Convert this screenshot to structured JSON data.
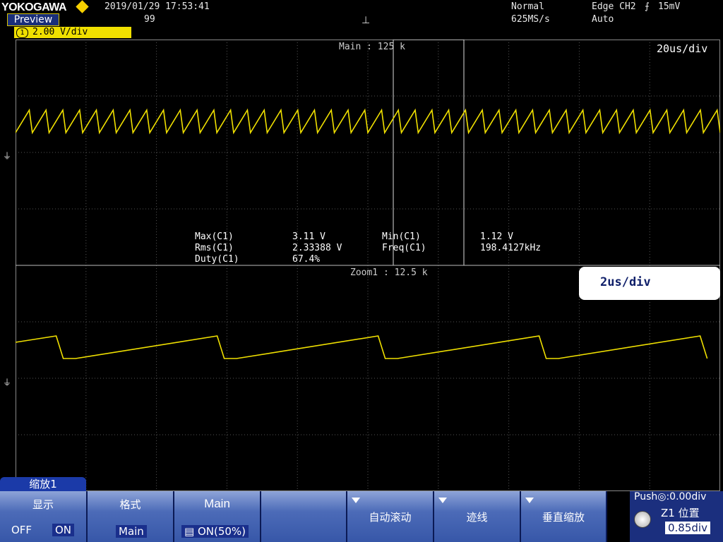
{
  "header": {
    "brand": "YOKOGAWA",
    "preview_label": "Preview",
    "datetime": "2019/01/29  17:53:41",
    "acq_count": "99",
    "acq_mode": "Normal",
    "sample_rate": "625MS/s",
    "trigger_type": "Edge CH2",
    "trigger_level": "15mV",
    "trigger_mode": "Auto",
    "trigger_position_symbol": "⊥"
  },
  "channel": {
    "number": "1",
    "scale": "2.00 V/div",
    "color": "#f0e000"
  },
  "main_window": {
    "label": "Main : 125 k",
    "timebase": "20us/div"
  },
  "measurements": [
    {
      "name": "Max(C1)",
      "value": "3.11 V"
    },
    {
      "name": "Min(C1)",
      "value": "1.12 V"
    },
    {
      "name": "Rms(C1)",
      "value": "2.33388 V"
    },
    {
      "name": "Freq(C1)",
      "value": "198.4127kHz"
    },
    {
      "name": "Duty(C1)",
      "value": "67.4%"
    }
  ],
  "zoom_window": {
    "label": "Zoom1 : 12.5 k",
    "timebase": "2us/div"
  },
  "menu": {
    "tab_label": "缩放1",
    "display": {
      "title": "显示",
      "off": "OFF",
      "on": "ON"
    },
    "format": {
      "title": "格式",
      "value": "Main"
    },
    "main": {
      "title": "Main",
      "value": "ON(50%)"
    },
    "auto_scroll": "自动滚动",
    "trace": "迹线",
    "vertical_zoom": "垂直缩放",
    "position": {
      "push_hint": "Push◎:0.00div",
      "label": "Z1 位置",
      "value": "0.85div"
    }
  },
  "colors": {
    "trace": "#f0e000",
    "softkey": "#4c6bb8",
    "grid": "#6a6a6a"
  }
}
